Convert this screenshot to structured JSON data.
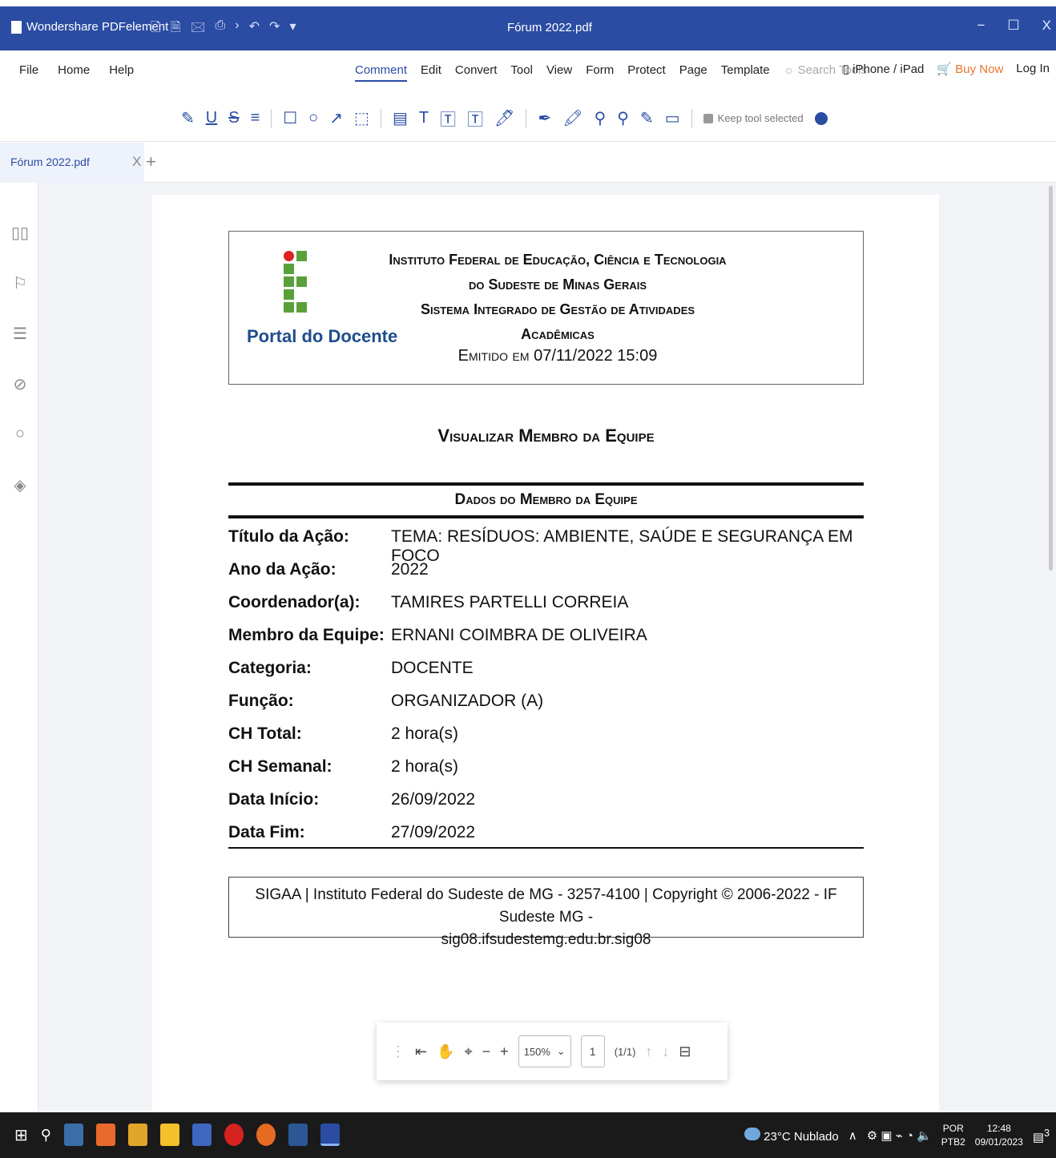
{
  "titlebar": {
    "app_name": "Wondershare PDFelement",
    "doc_title": "Fórum 2022.pdf",
    "quick_icons": [
      "🗋",
      "🗎",
      "🖂",
      "⎙",
      "›",
      "↶",
      "↷",
      "▾"
    ],
    "win_buttons": [
      "−",
      "☐",
      "X"
    ]
  },
  "menu": {
    "left": [
      "File",
      "Home",
      "Help"
    ],
    "center": [
      "Comment",
      "Edit",
      "Convert",
      "Tool",
      "View",
      "Form",
      "Protect",
      "Page",
      "Template"
    ],
    "active": "Comment",
    "search_placeholder": "Search Tools",
    "device": "iPhone / iPad",
    "buy": "Buy Now",
    "login": "Log In"
  },
  "toolbar": {
    "tool_icons": [
      "✎",
      "U",
      "S",
      "≡",
      "☐",
      "○",
      "↗",
      "⬚",
      "▤",
      "T",
      "🅃",
      "🅃",
      "🖊",
      "✒",
      "🖍",
      "⚲",
      "⚲",
      "✎",
      "▭"
    ],
    "keep_label": "Keep tool selected"
  },
  "tab": {
    "label": "Fórum 2022.pdf",
    "close": "X",
    "add": "+"
  },
  "sidebar_icons": [
    "thumbnails-icon",
    "bookmark-icon",
    "comment-icon",
    "attachment-icon",
    "search-icon",
    "layers-icon"
  ],
  "document": {
    "portal": "Portal do Docente",
    "institution_lines": [
      "Instituto Federal de Educação, Ciência e Tecnologia",
      "do Sudeste de Minas Gerais",
      "Sistema Integrado de Gestão de Atividades",
      "Acadêmicas"
    ],
    "emitted": "Emitido em 07/11/2022 15:09",
    "page_title": "Visualizar Membro da Equipe",
    "section_title": "Dados do Membro da Equipe",
    "rows": [
      {
        "label": "Título da Ação:",
        "value": "TEMA: RESÍDUOS: AMBIENTE, SAÚDE E SEGURANÇA EM FOCO"
      },
      {
        "label": "Ano da Ação:",
        "value": "2022"
      },
      {
        "label": "Coordenador(a):",
        "value": "TAMIRES PARTELLI CORREIA"
      },
      {
        "label": "Membro da Equipe:",
        "value": "ERNANI COIMBRA DE OLIVEIRA"
      },
      {
        "label": "Categoria:",
        "value": "DOCENTE"
      },
      {
        "label": "Função:",
        "value": "ORGANIZADOR (A)"
      },
      {
        "label": "CH Total:",
        "value": "2 hora(s)"
      },
      {
        "label": "CH Semanal:",
        "value": "2 hora(s)"
      },
      {
        "label": "Data Início:",
        "value": "26/09/2022"
      },
      {
        "label": "Data Fim:",
        "value": "27/09/2022"
      }
    ],
    "footer_line1": "SIGAA | Instituto Federal do Sudeste de MG - 3257-4100 | Copyright © 2006-2022 - IF Sudeste MG -",
    "footer_line2": "sig08.ifsudestemg.edu.br.sig08"
  },
  "floatbar": {
    "zoom": "150%",
    "page": "1",
    "of": "(1/1)"
  },
  "taskbar": {
    "weather": "23°C Nublado",
    "lang1": "POR",
    "lang2": "PTB2",
    "time": "12:48",
    "date": "09/01/2023",
    "notifications": "3"
  },
  "colors": {
    "accent": "#2b4ca3",
    "buy": "#e8742a",
    "taskbar": "#1a1a1a"
  }
}
